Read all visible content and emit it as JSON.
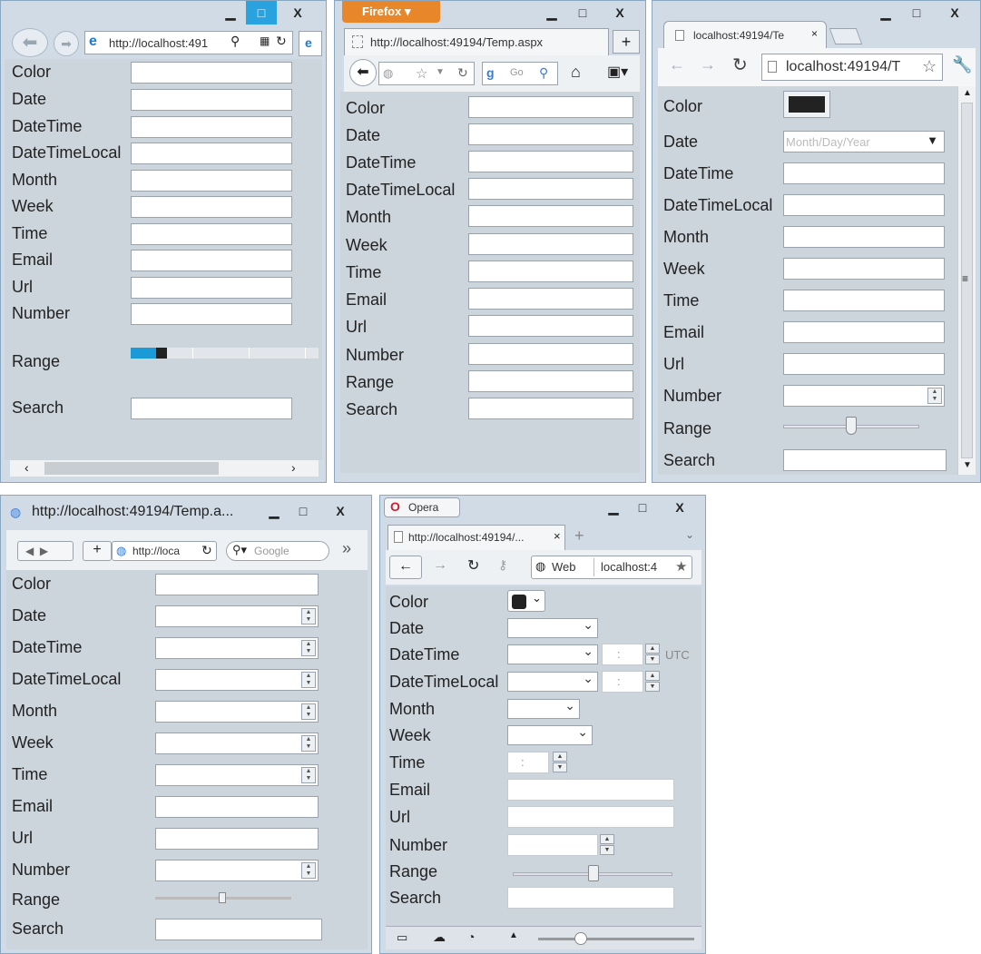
{
  "fields": [
    "Color",
    "Date",
    "DateTime",
    "DateTimeLocal",
    "Month",
    "Week",
    "Time",
    "Email",
    "Url",
    "Number",
    "Range",
    "Search"
  ],
  "ie": {
    "address": "http://localhost:491"
  },
  "firefox": {
    "app_button": "Firefox",
    "tab_title": "http://localhost:49194/Temp.aspx",
    "search_placeholder": "Go"
  },
  "chrome": {
    "tab_title": "localhost:49194/Te",
    "address": "localhost:49194/T",
    "date_placeholder": "Month/Day/Year"
  },
  "safari": {
    "window_title": "http://localhost:49194/Temp.a...",
    "address": "http://loca",
    "search_placeholder": "Google"
  },
  "opera": {
    "app_button": "Opera",
    "tab_title": "http://localhost:49194/...",
    "web_label": "Web",
    "address": "localhost:4",
    "utc_label": "UTC",
    "time_placeholder": ":"
  },
  "window_controls": {
    "minimize": "▁",
    "maximize": "□",
    "close": "X"
  },
  "colors": {
    "chrome_swatch": "#222222",
    "ie_range_fill": "#1a9ad6",
    "firefox_button": "#e8862a"
  }
}
